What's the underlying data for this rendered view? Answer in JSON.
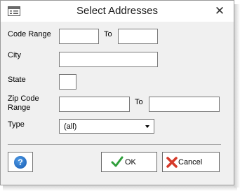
{
  "dialog": {
    "title": "Select Addresses",
    "close_glyph": "✕",
    "title_icon": "window-icon"
  },
  "fields": {
    "code_range": {
      "label": "Code Range",
      "from_value": "",
      "to_label": "To",
      "to_value": ""
    },
    "city": {
      "label": "City",
      "value": ""
    },
    "state": {
      "label": "State",
      "value": ""
    },
    "zip_range": {
      "label_line1": "Zip Code",
      "label_line2": "Range",
      "from_value": "",
      "to_label": "To",
      "to_value": ""
    },
    "type": {
      "label": "Type",
      "selected": "(all)"
    }
  },
  "buttons": {
    "help_glyph": "?",
    "ok_label": "OK",
    "cancel_label": "Cancel"
  },
  "colors": {
    "help_icon": "#1e6fd0",
    "ok_check": "#2e9e3a",
    "cancel_x": "#d63a2a"
  }
}
